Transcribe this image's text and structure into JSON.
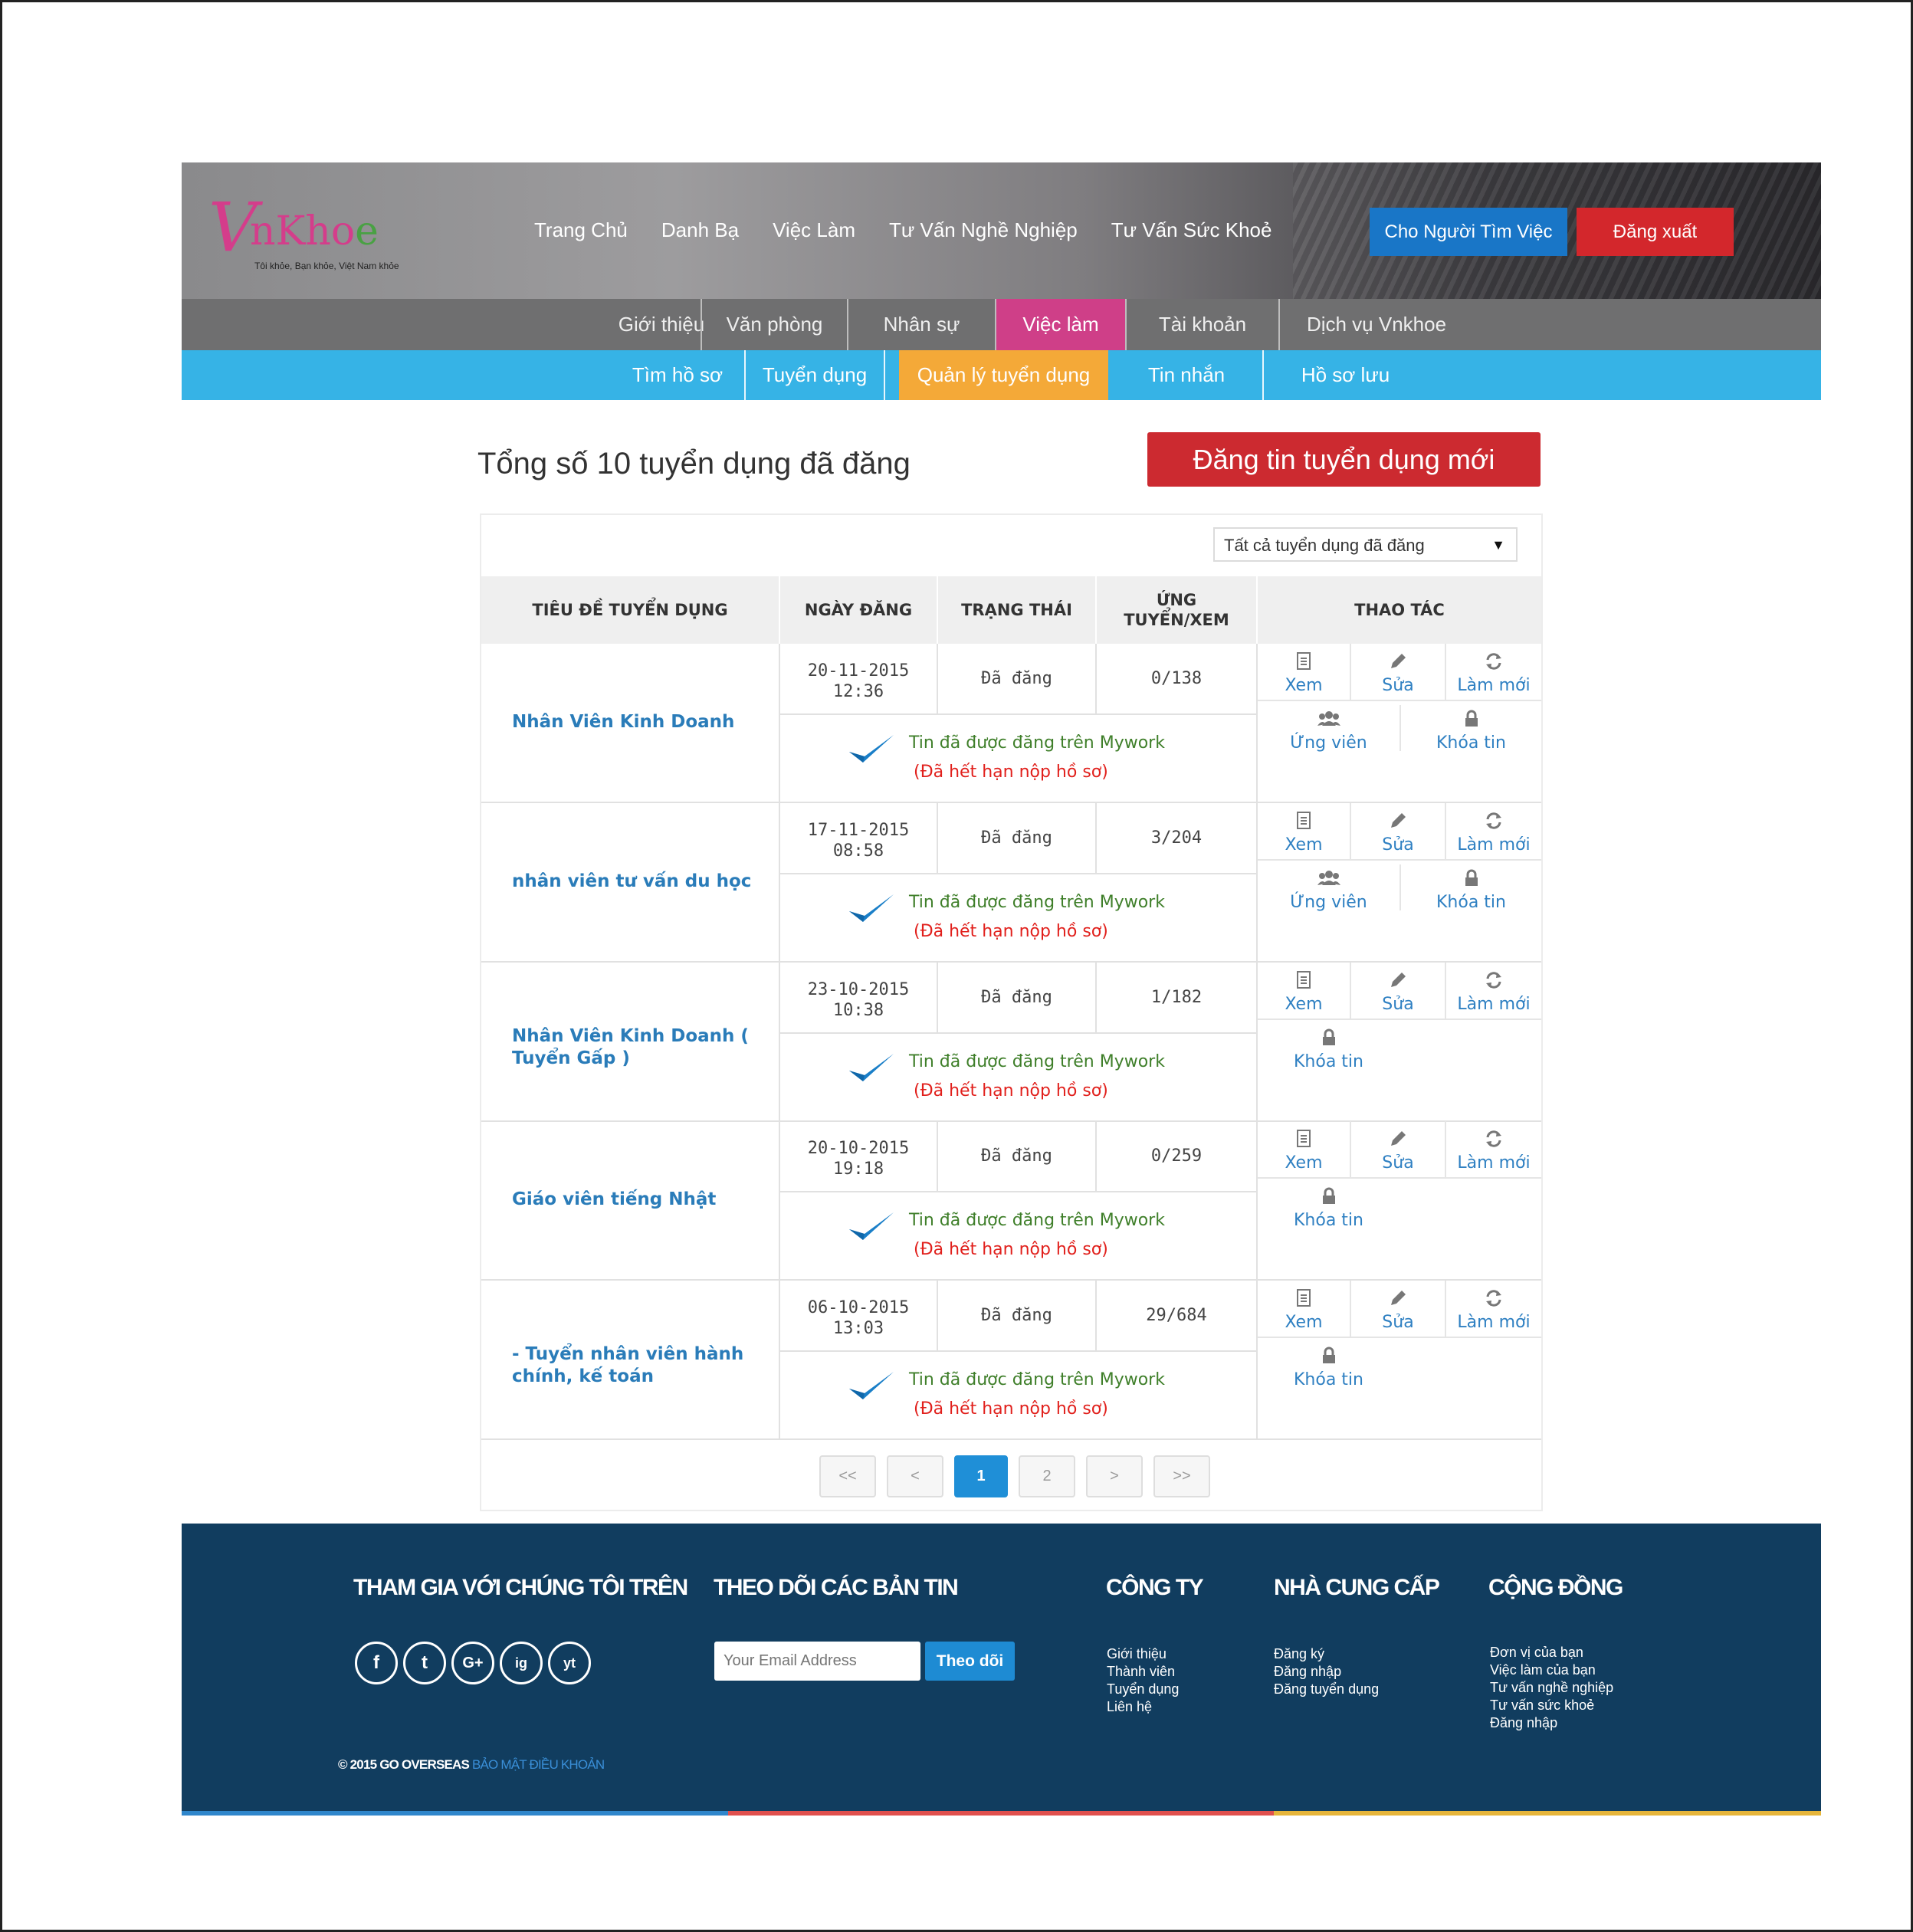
{
  "brand": {
    "name_prefix": "V",
    "name_main": "nKho",
    "name_end": "e",
    "tagline": "Tôi khỏe, Bạn khỏe, Việt Nam khỏe"
  },
  "mainnav": [
    "Trang Chủ",
    "Danh Bạ",
    "Việc Làm",
    "Tư Vấn Nghề Nghiệp",
    "Tư Vấn Sức Khoẻ"
  ],
  "header_buttons": {
    "seeker": "Cho Người Tìm Việc",
    "logout": "Đăng xuất"
  },
  "subnav1": [
    "Giới thiệu",
    "Văn phòng",
    "Nhân sự",
    "Việc làm",
    "Tài khoản",
    "Dịch vụ Vnkhoe"
  ],
  "subnav2": [
    "Tìm hồ sơ",
    "Tuyển dụng",
    "Quản lý tuyển dụng",
    "Tin nhắn",
    "Hồ sơ lưu"
  ],
  "page": {
    "title": "Tổng số 10 tuyển dụng đã đăng",
    "new_button": "Đăng tin tuyển dụng mới"
  },
  "filter": {
    "selected": "Tất cả tuyển dụng đã đăng"
  },
  "table": {
    "headers": [
      "TIÊU ĐỀ TUYỂN DỤNG",
      "NGÀY ĐĂNG",
      "TRẠNG THÁI",
      "ỨNG TUYỂN/XEM",
      "THAO TÁC"
    ],
    "rows": [
      {
        "title": "Nhân Viên Kinh Doanh",
        "date": "20-11-2015",
        "time": "12:36",
        "status": "Đã đăng",
        "count": "0/138"
      },
      {
        "title": "nhân viên tư vấn du học",
        "date": "17-11-2015",
        "time": "08:58",
        "status": "Đã đăng",
        "count": "3/204"
      },
      {
        "title": "Nhân Viên Kinh Doanh ( Tuyển Gấp )",
        "date": "23-10-2015",
        "time": "10:38",
        "status": "Đã đăng",
        "count": "1/182"
      },
      {
        "title": "Giáo viên tiếng Nhật",
        "date": "20-10-2015",
        "time": "19:18",
        "status": "Đã đăng",
        "count": "0/259"
      },
      {
        "title": "- Tuyển nhân viên hành chính, kế toán",
        "date": "06-10-2015",
        "time": "13:03",
        "status": "Đã đăng",
        "count": "29/684"
      }
    ],
    "note_ok": "Tin đã được đăng trên Mywork",
    "note_expired": "(Đã hết hạn nộp hồ sơ)",
    "actions": {
      "view": "Xem",
      "edit": "Sửa",
      "refresh": "Làm mới",
      "applicants": "Ứng viên",
      "lock": "Khóa tin"
    }
  },
  "pagination": [
    "<<",
    "<",
    "1",
    "2",
    ">",
    ">>"
  ],
  "footer": {
    "join": "THAM GIA VỚI CHÚNG TÔI TRÊN",
    "newsletter": "THEO DÕI CÁC BẢN TIN",
    "email_placeholder": "Your Email Address",
    "follow": "Theo dõi",
    "company": {
      "title": "CÔNG TY",
      "links": [
        "Giới thiệu",
        "Thành viên",
        "Tuyển dụng",
        "Liên hệ"
      ]
    },
    "provider": {
      "title": "NHÀ CUNG CẤP",
      "links": [
        "Đăng ký",
        "Đăng nhập",
        "Đăng tuyển dụng"
      ]
    },
    "community": {
      "title": "CỘNG ĐỒNG",
      "links": [
        "Đơn vị của bạn",
        "Việc làm của bạn",
        "Tư vấn nghề nghiệp",
        "Tư vấn sức khoẻ",
        "Đăng nhập"
      ]
    },
    "copyright": "© 2015 GO OVERSEAS",
    "terms": "BẢO MẬT ĐIỀU KHOẢN",
    "social": [
      "f",
      "t",
      "G+",
      "ig",
      "yt"
    ]
  },
  "colors": {
    "blue": "#1976c7",
    "red": "#d3272c",
    "pink": "#cf3f88",
    "cyan": "#36b3e6",
    "orange": "#f4a938",
    "footer": "#113d5f"
  }
}
